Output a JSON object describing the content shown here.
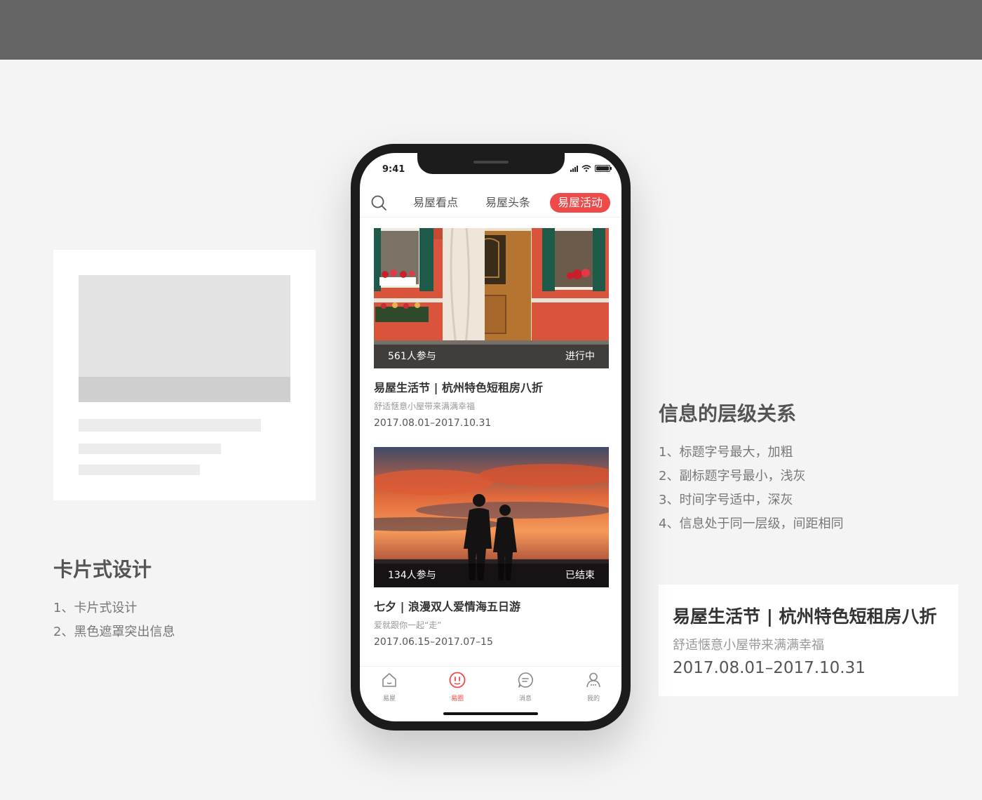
{
  "left_section": {
    "title": "卡片式设计",
    "items": [
      "1、卡片式设计",
      "2、黑色遮罩突出信息"
    ]
  },
  "right_section": {
    "title": "信息的层级关系",
    "items": [
      "1、标题字号最大，加粗",
      "2、副标题字号最小，浅灰",
      "3、时间字号适中，深灰",
      "4、信息处于同一层级，间距相同"
    ],
    "sample_card": {
      "title": "易屋生活节 | 杭州特色短租房八折",
      "subtitle": "舒适惬意小屋带来满满幸福",
      "date": "2017.08.01–2017.10.31"
    }
  },
  "phone": {
    "status_time": "9:41",
    "nav_tabs": [
      {
        "label": "易屋看点",
        "active": false
      },
      {
        "label": "易屋头条",
        "active": false
      },
      {
        "label": "易屋活动",
        "active": true
      }
    ],
    "cards": [
      {
        "participants": "561人参与",
        "status": "进行中",
        "title": "易屋生活节 | 杭州特色短租房八折",
        "subtitle": "舒适惬意小屋带来满满幸福",
        "date": "2017.08.01–2017.10.31",
        "image": "red-house-door-photo"
      },
      {
        "participants": "134人参与",
        "status": "已结束",
        "title": "七夕 | 浪漫双人爱情海五日游",
        "subtitle": "爱就跟你一起“走”",
        "date": "2017.06.15–2017.07–15",
        "image": "sunset-couple-photo"
      }
    ],
    "tabbar": [
      {
        "label": "易屋",
        "icon": "home-icon",
        "active": false
      },
      {
        "label": "易圈",
        "icon": "circle-face-icon",
        "active": true
      },
      {
        "label": "消息",
        "icon": "message-icon",
        "active": false
      },
      {
        "label": "我的",
        "icon": "user-icon",
        "active": false
      }
    ]
  },
  "colors": {
    "accent": "#ef4a4a",
    "top_band": "#666566",
    "background": "#f5f4f4"
  }
}
